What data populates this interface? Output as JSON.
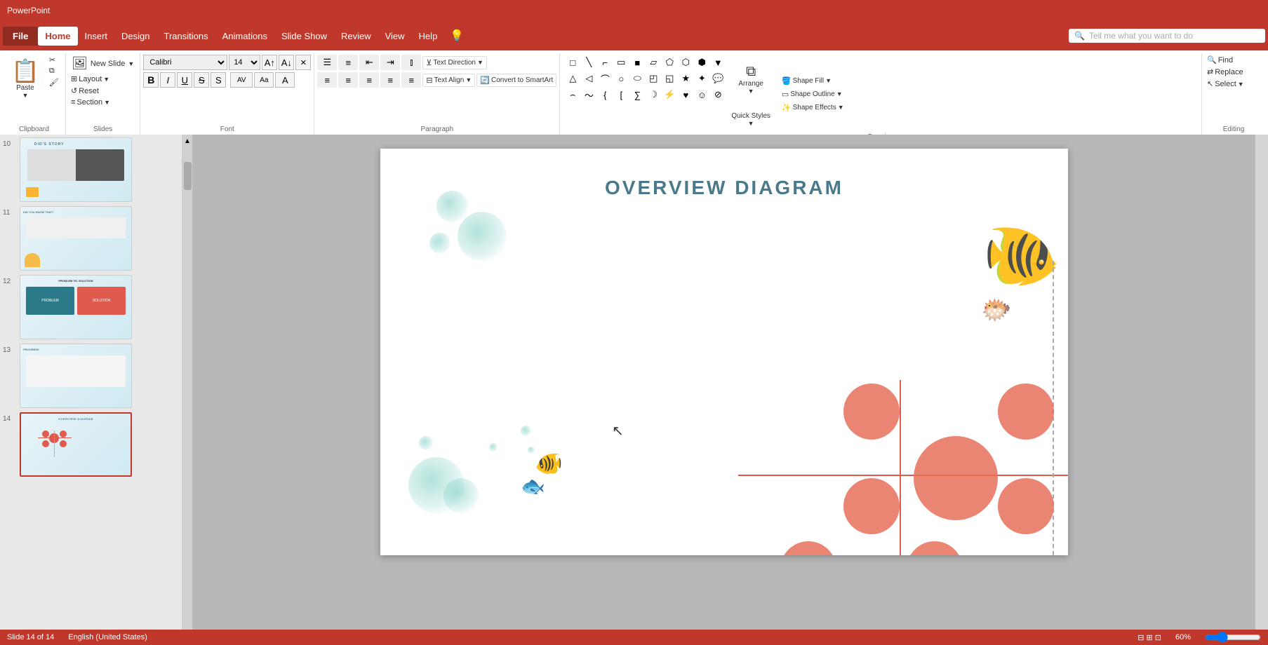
{
  "app": {
    "title": "PowerPoint"
  },
  "menu": {
    "file": "File",
    "home": "Home",
    "insert": "Insert",
    "design": "Design",
    "transitions": "Transitions",
    "animations": "Animations",
    "slideshow": "Slide Show",
    "review": "Review",
    "view": "View",
    "help": "Help",
    "search_placeholder": "Tell me what you want to do"
  },
  "ribbon": {
    "groups": {
      "clipboard": {
        "label": "Clipboard",
        "paste": "Paste",
        "cut": "✂",
        "copy": "⧉",
        "format_painter": "🖌"
      },
      "slides": {
        "label": "Slides",
        "new_slide": "New Slide",
        "layout": "Layout",
        "reset": "Reset",
        "section": "Section"
      },
      "font": {
        "label": "Font",
        "family": "Calibri",
        "size": "14",
        "bold": "B",
        "italic": "I",
        "underline": "U",
        "strikethrough": "S",
        "shadow": "S"
      },
      "paragraph": {
        "label": "Paragraph",
        "text_direction": "Text Direction",
        "align_text": "Align Text",
        "convert_smartart": "Convert to SmartArt"
      },
      "drawing": {
        "label": "Drawing",
        "arrange": "Arrange",
        "quick_styles": "Quick Styles",
        "shape_fill": "Shape Fill",
        "shape_outline": "Shape Outline",
        "shape_effects": "Shape Effects"
      },
      "editing": {
        "label": "Editing",
        "find": "Find",
        "replace": "Replace",
        "select": "Select"
      }
    }
  },
  "slides": [
    {
      "num": "10",
      "active": false
    },
    {
      "num": "11",
      "active": false
    },
    {
      "num": "12",
      "active": false
    },
    {
      "num": "13",
      "active": false
    },
    {
      "num": "14",
      "active": true
    }
  ],
  "current_slide": {
    "title": "OVERVIEW DIAGRAM"
  },
  "status": {
    "slide_info": "Slide 14 of 14",
    "language": "English (United States)",
    "view": "Normal View",
    "zoom": "60%"
  }
}
